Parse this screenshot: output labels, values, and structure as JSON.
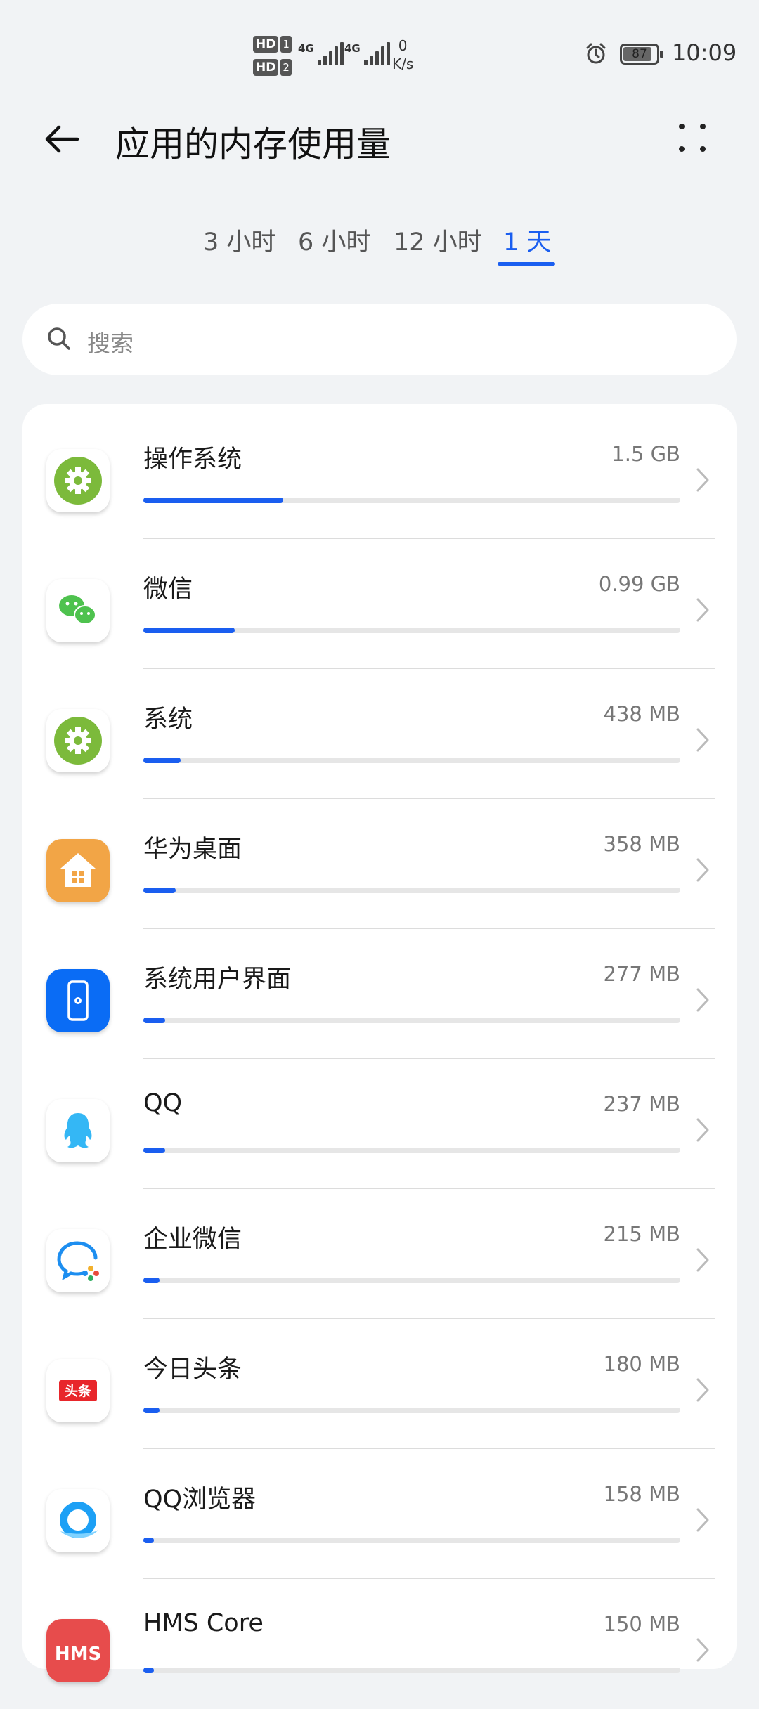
{
  "status_bar": {
    "hd1": "HD",
    "hd1_num": "1",
    "hd2": "HD",
    "hd2_num": "2",
    "sim1_label": "4G",
    "sim2_label": "4G",
    "net_speed_value": "0",
    "net_speed_unit": "K/s",
    "battery_level": 87,
    "battery_text": "87",
    "time": "10:09"
  },
  "header": {
    "title": "应用的内存使用量",
    "back_icon": "arrow-left-icon",
    "more_icon": "more-dots-icon"
  },
  "tabs": [
    {
      "label": "3 小时",
      "active": false
    },
    {
      "label": "6 小时",
      "active": false
    },
    {
      "label": "12 小时",
      "active": false
    },
    {
      "label": "1 天",
      "active": true
    }
  ],
  "search": {
    "placeholder": "搜索",
    "icon": "search-icon"
  },
  "colors": {
    "accent": "#1a5ef0",
    "background": "#f1f3f5",
    "track": "#e6e6e6"
  },
  "apps": [
    {
      "name": "操作系统",
      "size": "1.5 GB",
      "usage_fraction": 0.26,
      "icon": "settings-gear-icon"
    },
    {
      "name": "微信",
      "size": "0.99 GB",
      "usage_fraction": 0.17,
      "icon": "wechat-icon"
    },
    {
      "name": "系统",
      "size": "438 MB",
      "usage_fraction": 0.07,
      "icon": "settings-gear-icon"
    },
    {
      "name": "华为桌面",
      "size": "358 MB",
      "usage_fraction": 0.06,
      "icon": "home-launcher-icon"
    },
    {
      "name": "系统用户界面",
      "size": "277 MB",
      "usage_fraction": 0.04,
      "icon": "phone-settings-icon"
    },
    {
      "name": "QQ",
      "size": "237 MB",
      "usage_fraction": 0.04,
      "icon": "qq-penguin-icon"
    },
    {
      "name": "企业微信",
      "size": "215 MB",
      "usage_fraction": 0.03,
      "icon": "wecom-icon"
    },
    {
      "name": "今日头条",
      "size": "180 MB",
      "usage_fraction": 0.03,
      "icon": "toutiao-icon"
    },
    {
      "name": "QQ浏览器",
      "size": "158 MB",
      "usage_fraction": 0.02,
      "icon": "qq-browser-icon"
    },
    {
      "name": "HMS Core",
      "size": "150 MB",
      "usage_fraction": 0.02,
      "icon": "hms-core-icon",
      "icon_text": "HMS"
    }
  ]
}
